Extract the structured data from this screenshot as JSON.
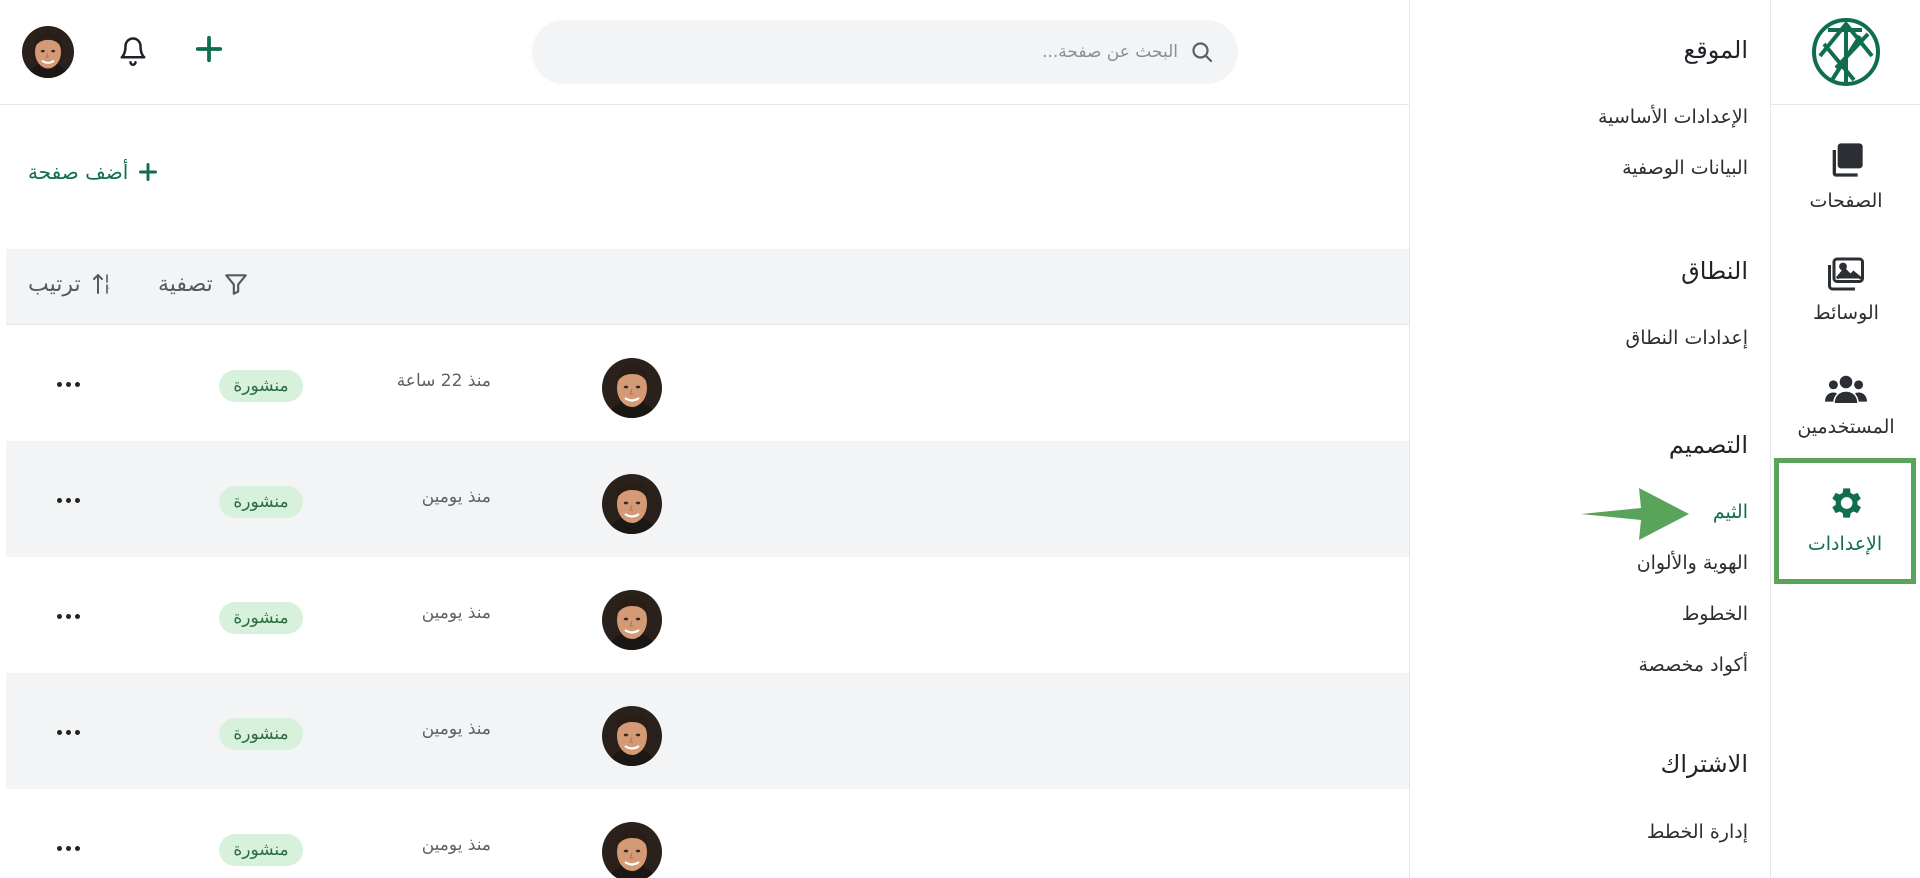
{
  "search": {
    "placeholder": "البحث عن صفحة..."
  },
  "rail": {
    "items": [
      {
        "label": "الصفحات",
        "icon": "pages-icon"
      },
      {
        "label": "الوسائط",
        "icon": "media-icon"
      },
      {
        "label": "المستخدمين",
        "icon": "users-icon"
      },
      {
        "label": "الإعدادات",
        "icon": "gear-icon",
        "active": true
      }
    ]
  },
  "settings": {
    "sections": [
      {
        "title": "الموقع",
        "links": [
          "الإعدادات الأساسية",
          "البيانات الوصفية"
        ]
      },
      {
        "title": "النطاق",
        "links": [
          "إعدادات النطاق"
        ]
      },
      {
        "title": "التصميم",
        "links": [
          "الثيم",
          "الهوية والألوان",
          "الخطوط",
          "أكواد مخصصة"
        ],
        "active_link": "الثيم"
      },
      {
        "title": "الاشتراك",
        "links": [
          "إدارة الخطط"
        ]
      }
    ]
  },
  "main": {
    "add_page_label": "أضف صفحة",
    "toolbar": {
      "filter_label": "تصفية",
      "sort_label": "ترتيب"
    },
    "rows": [
      {
        "time": "منذ 22 ساعة",
        "status": "منشورة"
      },
      {
        "time": "منذ يومين",
        "status": "منشورة"
      },
      {
        "time": "منذ يومين",
        "status": "منشورة"
      },
      {
        "time": "منذ يومين",
        "status": "منشورة"
      },
      {
        "time": "منذ يومين",
        "status": "منشورة"
      }
    ]
  },
  "colors": {
    "accent": "#0f6e4b",
    "highlight_box": "#5aa35a",
    "arrow": "#5aa35a",
    "badge_bg": "#d8f1dd"
  }
}
